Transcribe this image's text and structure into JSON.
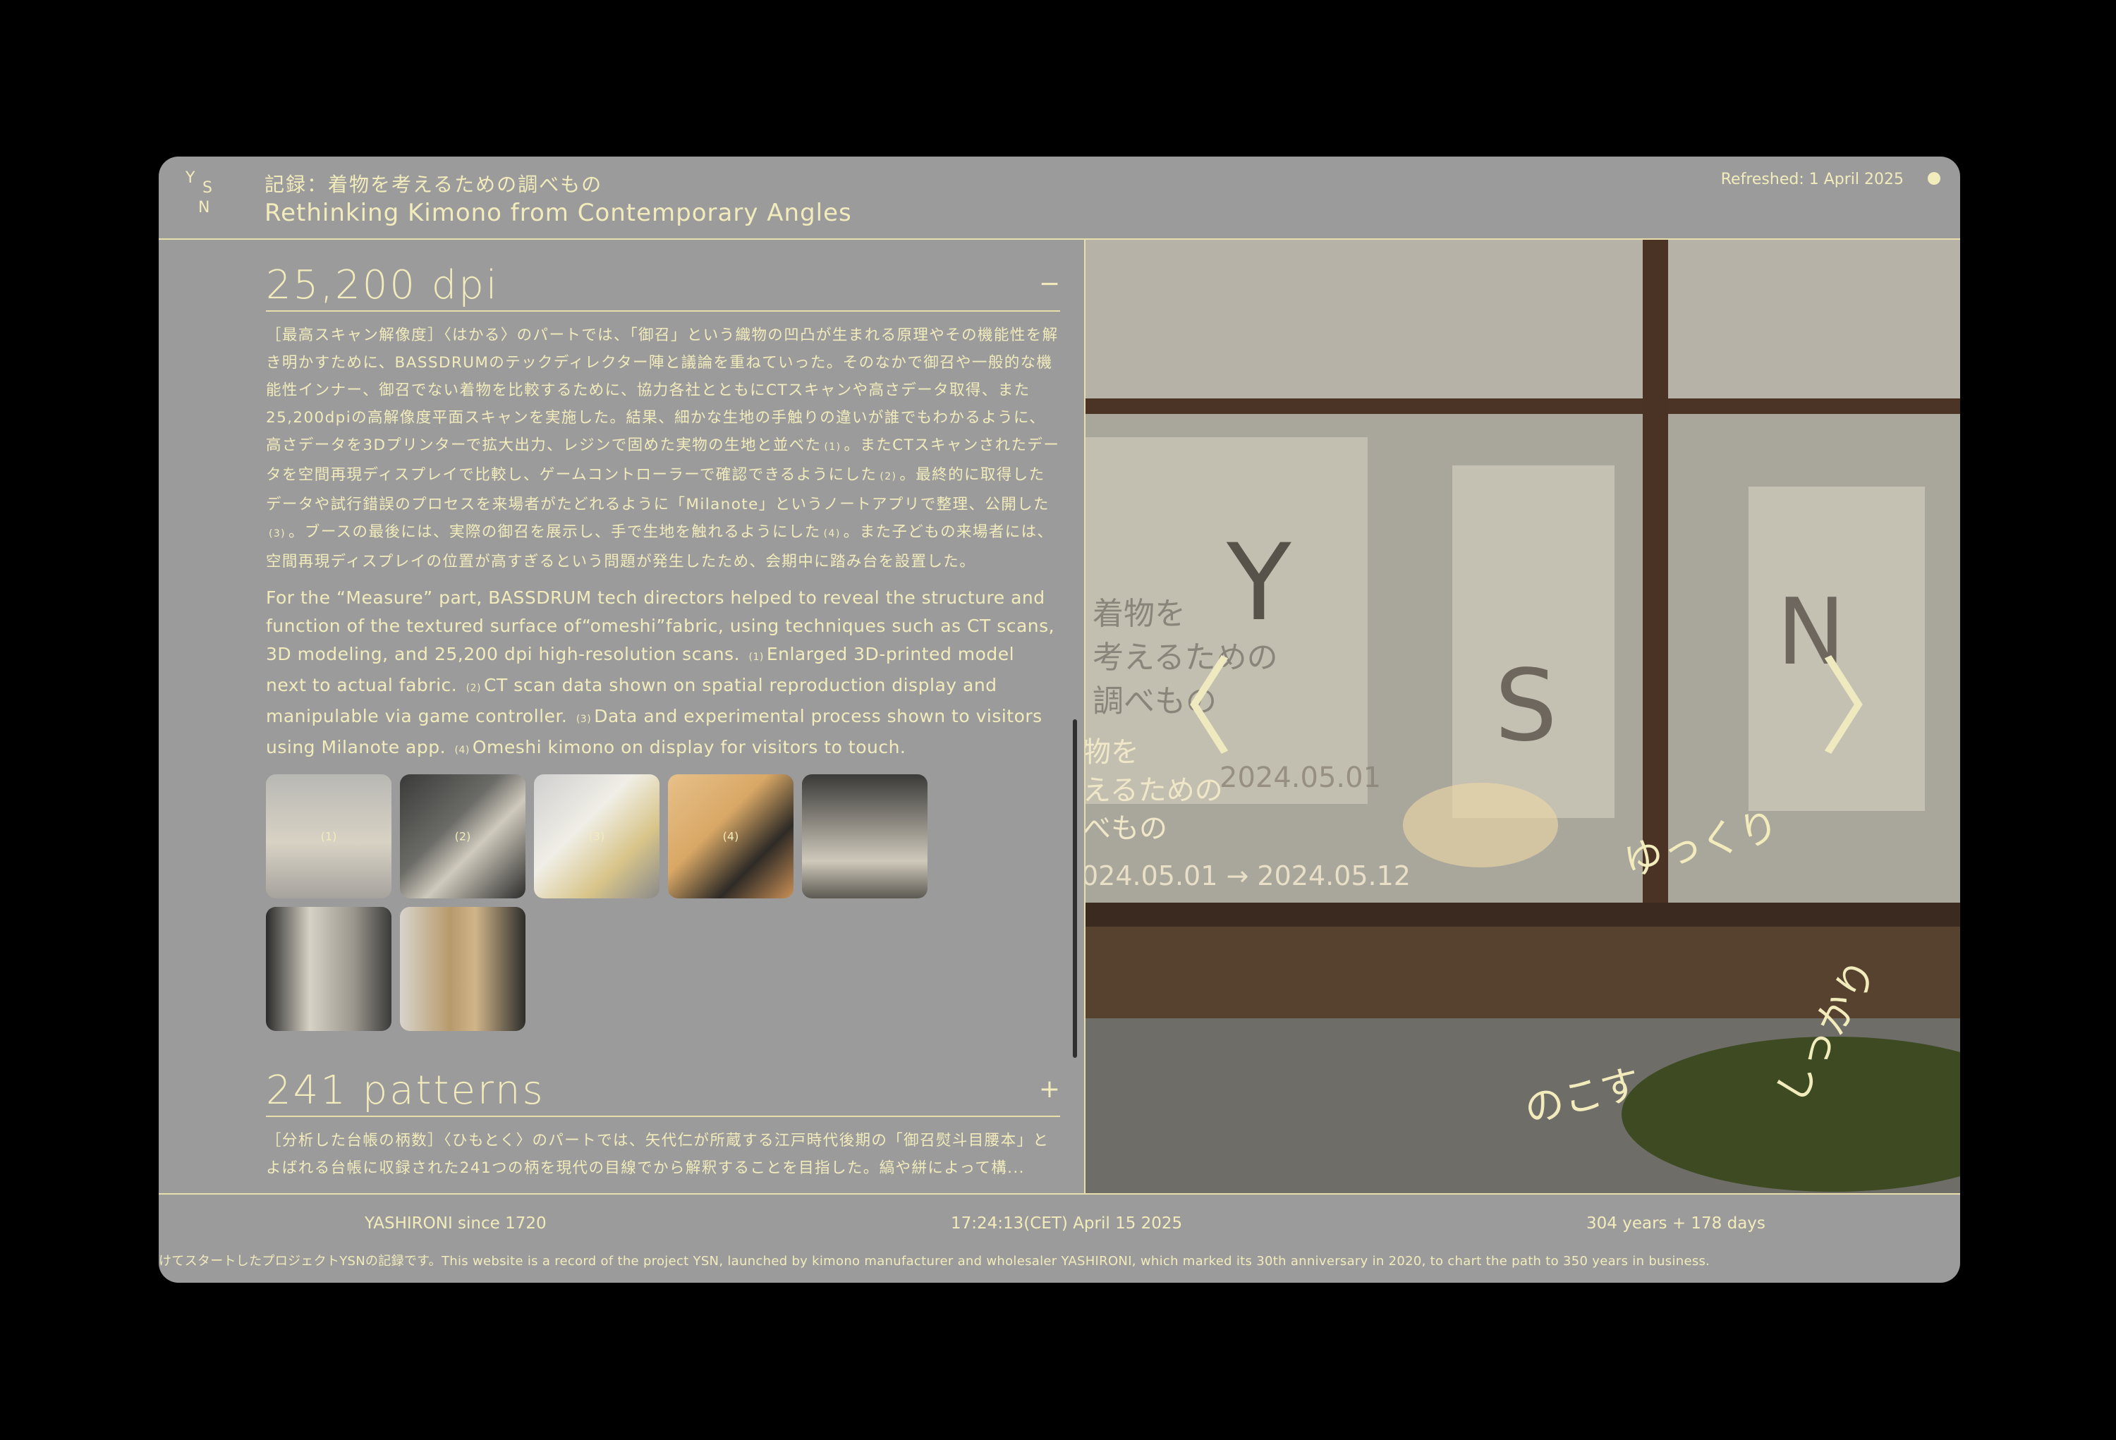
{
  "header": {
    "logo_letters": [
      "Y",
      "S",
      "N"
    ],
    "title_ja": "記録：着物を考えるための調べもの",
    "title_en": "Rethinking Kimono from Contemporary Angles",
    "refreshed": "Refreshed: 1 April 2025"
  },
  "sections": [
    {
      "title": "25,200 dpi",
      "toggle": "−",
      "body_ja": [
        "［最高スキャン解像度］〈はかる〉のパートでは、「御召」という織物の凹凸が生まれる原理やその機能性を解き明かすために、BASSDRUMのテックディレクター陣と議論を重ねていった。そのなかで御召や一般的な機能性インナー、御召でない着物を比較するために、協力各社とともにCTスキャンや高さデータ取得、また25,200dpiの高解像度平面スキャンを実施した。結果、細かな生地の手触りの違いが誰でもわかるように、高さデータを3Dプリンターで拡大出力、レジンで固めた実物の生地と並べた",
        "。またCTスキャンされたデータを空間再現ディスプレイで比較し、ゲームコントローラーで確認できるようにした",
        "。最終的に取得したデータや試行錯誤のプロセスを来場者がたどれるように「Milanote」というノートアプリで整理、公開した",
        "。ブースの最後には、実際の御召を展示し、手で生地を触れるようにした",
        "。また子どもの来場者には、空間再現ディスプレイの位置が高すぎるという問題が発生したため、会期中に踏み台を設置した。"
      ],
      "refs": [
        "(1)",
        "(2)",
        "(3)",
        "(4)"
      ],
      "body_en": [
        "For the “Measure” part, BASSDRUM tech directors helped to reveal the structure and function of the textured surface of“omeshi”fabric, using techniques such as CT scans, 3D modeling, and 25,200 dpi high-resolution scans.",
        "Enlarged 3D-printed model next to actual fabric.",
        "CT scan data shown on spatial reproduction display and manipulable via game controller.",
        "Data and experimental process shown to visitors using Milanote app.",
        "Omeshi kimono on display for visitors to touch."
      ],
      "thumbnails": [
        "(1)",
        "(2)",
        "(3)",
        "(4)",
        "",
        "",
        ""
      ]
    },
    {
      "title": "241 patterns",
      "toggle": "+",
      "body_ja": "［分析した台帳の柄数］〈ひもとく〉のパートでは、矢代仁が所蔵する江戸時代後期の「御召熨斗目腰本」とよばれる台帳に収録された241つの柄を現代の目線でから解釈することを目指した。縞や絣によって構..."
    }
  ],
  "slideshow": {
    "window_letters": [
      "Y",
      "S",
      "N"
    ],
    "poster_ja": [
      "着物を",
      "考えるための",
      "調べもの"
    ],
    "poster_ja_front": [
      "物を",
      "えるための",
      "べもの"
    ],
    "poster_dates_faint": "2024.05.01",
    "poster_dates": "024.05.01 → 2024.05.12",
    "handwriting": [
      "ゆっくり",
      "しっかり",
      "のこす"
    ],
    "prev": "〈",
    "next": "〉"
  },
  "footer": {
    "since": "YASHIRONI since 1720",
    "clock": "17:24:13(CET) April 15 2025",
    "age": "304 years + 178 days",
    "ticker": "けてスタートしたプロジェクトYSNの記録です。This website is a record of the project YSN, launched by kimono manufacturer and wholesaler YASHIRONI, which marked its 30th anniversary in 2020, to chart the path to 350 years in business."
  },
  "colors": {
    "background": "#000000",
    "panel": "#9b9b9b",
    "text": "#f2ecbc",
    "rule": "#e6dfa9"
  }
}
